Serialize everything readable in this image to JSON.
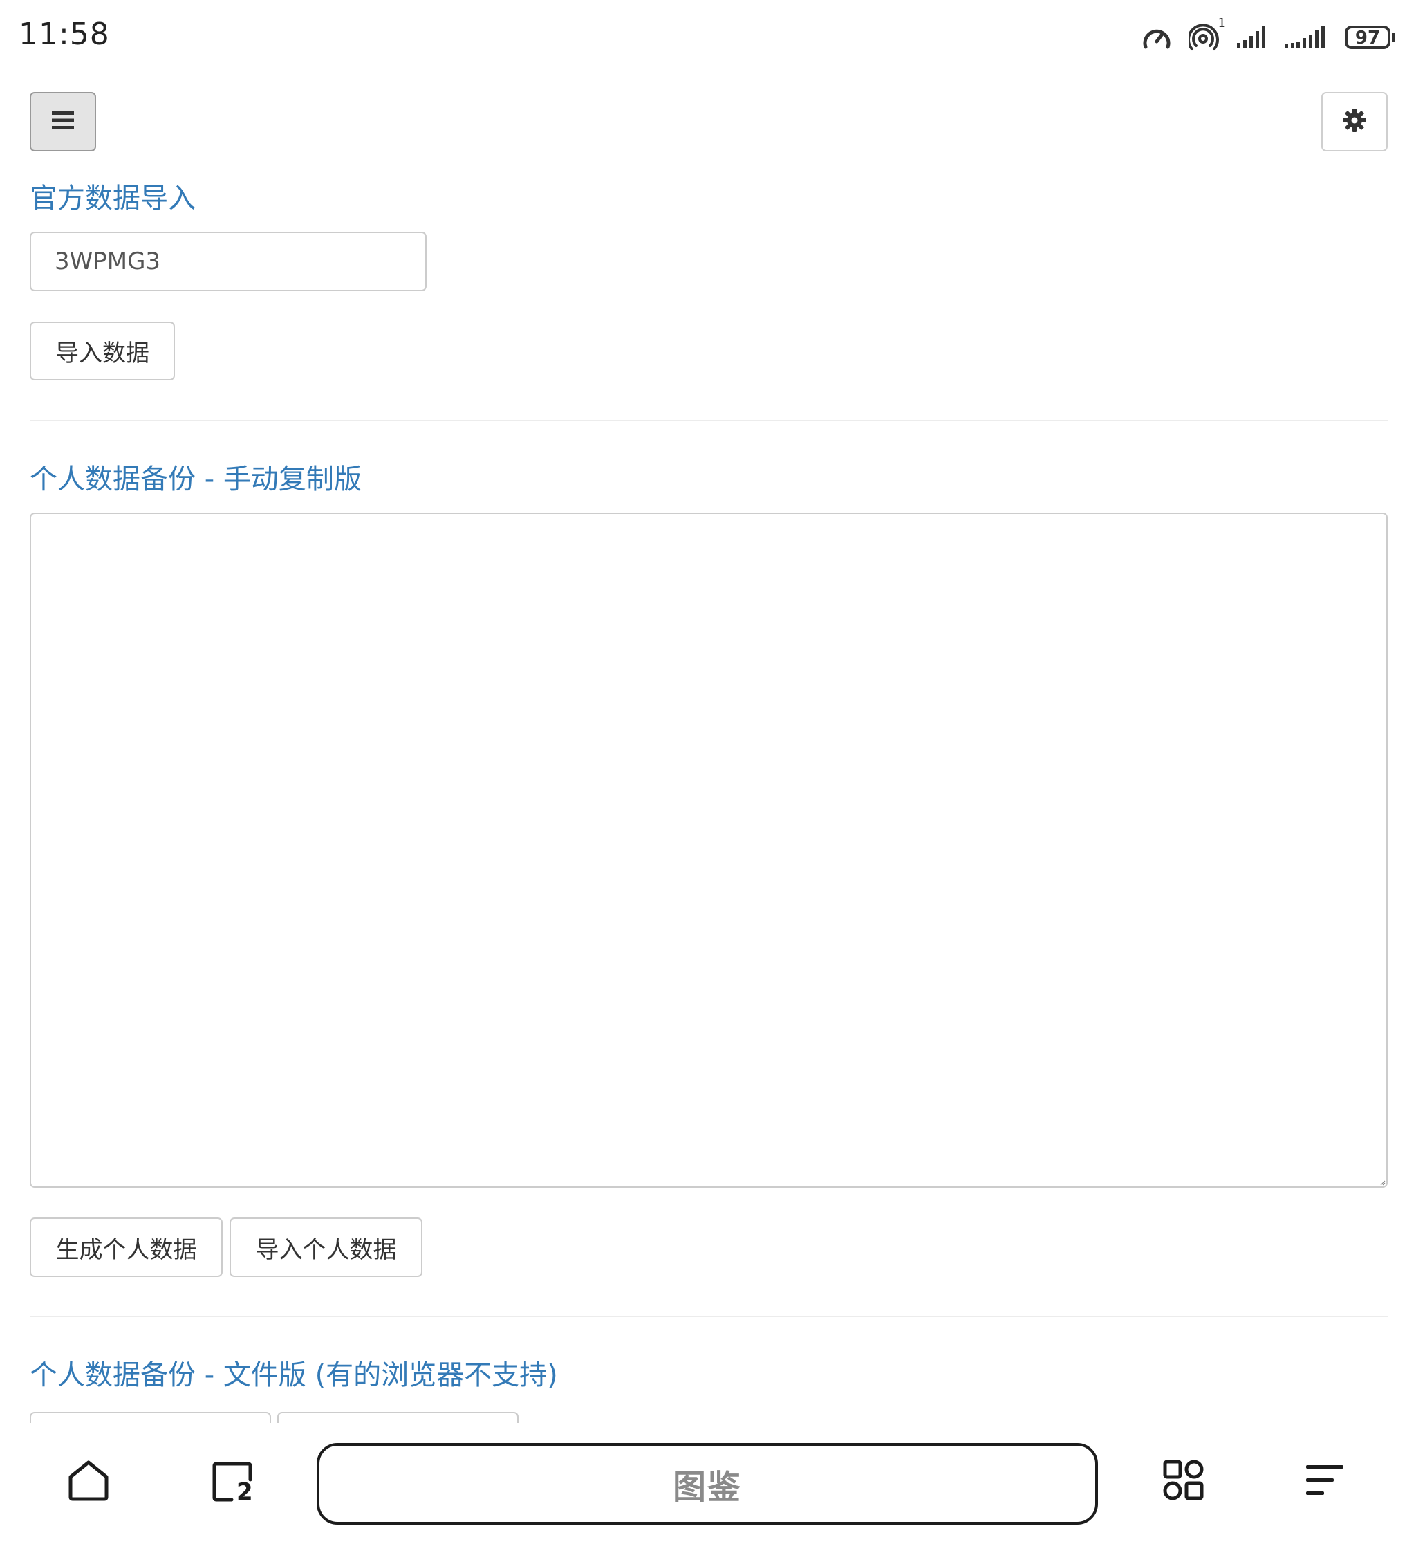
{
  "status_bar": {
    "time": "11:58",
    "hotspot_badge": "1",
    "battery_level": "97",
    "icons": [
      "speed-meter-icon",
      "hotspot-icon",
      "signal-bars-icon",
      "signal-bars-icon"
    ]
  },
  "toolbar": {
    "menu_icon": "hamburger-menu-icon",
    "settings_icon": "gear-icon"
  },
  "official_import": {
    "title": "官方数据导入",
    "input_value": "3WPMG3",
    "import_button": "导入数据"
  },
  "manual_backup": {
    "title": "个人数据备份 - 手动复制版",
    "textarea_value": "",
    "generate_button": "生成个人数据",
    "import_button": "导入个人数据"
  },
  "file_backup": {
    "title": "个人数据备份 - 文件版 (有的浏览器不支持)"
  },
  "browser_bar": {
    "home_icon": "home-icon",
    "tabs_icon": "tabs-icon",
    "tab_count": "2",
    "address_text": "图鉴",
    "apps_icon": "apps-grid-icon",
    "menu_icon": "menu-lines-icon"
  },
  "colors": {
    "accent": "#337ab7",
    "border": "#cccccc",
    "text": "#333333"
  }
}
